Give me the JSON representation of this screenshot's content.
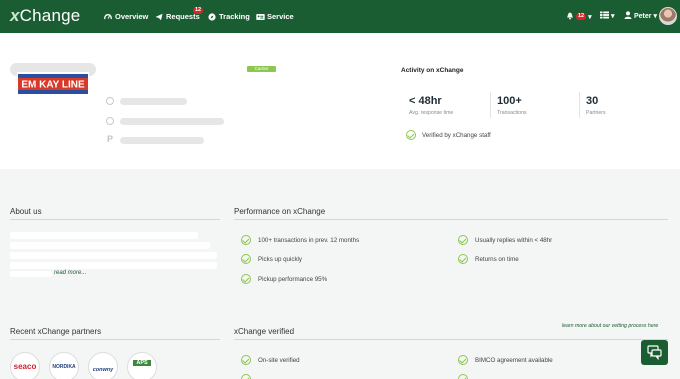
{
  "header": {
    "logo": "Change",
    "logo_x": "x",
    "nav": [
      {
        "label": "Overview",
        "icon": "dashboard-icon"
      },
      {
        "label": "Requests",
        "icon": "send-icon",
        "badge": "12"
      },
      {
        "label": "Tracking",
        "icon": "compass-icon"
      },
      {
        "label": "Service",
        "icon": "id-card-icon"
      }
    ],
    "notifications_badge": "12",
    "user_name": "Peter"
  },
  "profile": {
    "carrier_tag": "Carrier",
    "company_logo_text": "EM KAY LINE",
    "activity": {
      "title": "Activity on xChange",
      "stats": [
        {
          "value": "< 48hr",
          "label": "Avg. response time"
        },
        {
          "value": "100+",
          "label": "Transactions"
        },
        {
          "value": "30",
          "label": "Partners"
        }
      ],
      "verified": "Verified by xChange staff"
    }
  },
  "about": {
    "title": "About us",
    "read_more": "read more..."
  },
  "performance": {
    "title": "Performance on xChange",
    "items": [
      "100+ transactions in prev. 12 months",
      "Usually replies within < 48hr",
      "Picks up quickly",
      "Returns on time",
      "Pickup performance 95%"
    ]
  },
  "partners": {
    "title": "Recent xChange partners",
    "logos": [
      "seaco",
      "NORDIKA",
      "conwny",
      "APS"
    ]
  },
  "verified_section": {
    "title": "xChange verified",
    "learn_more": "learn more about our vetting process here",
    "items": [
      "On-site verified",
      "BIMCO agreement available"
    ]
  },
  "colors": {
    "brand": "#1b5d32",
    "accent": "#8cc84f",
    "badge": "#d9262b"
  }
}
